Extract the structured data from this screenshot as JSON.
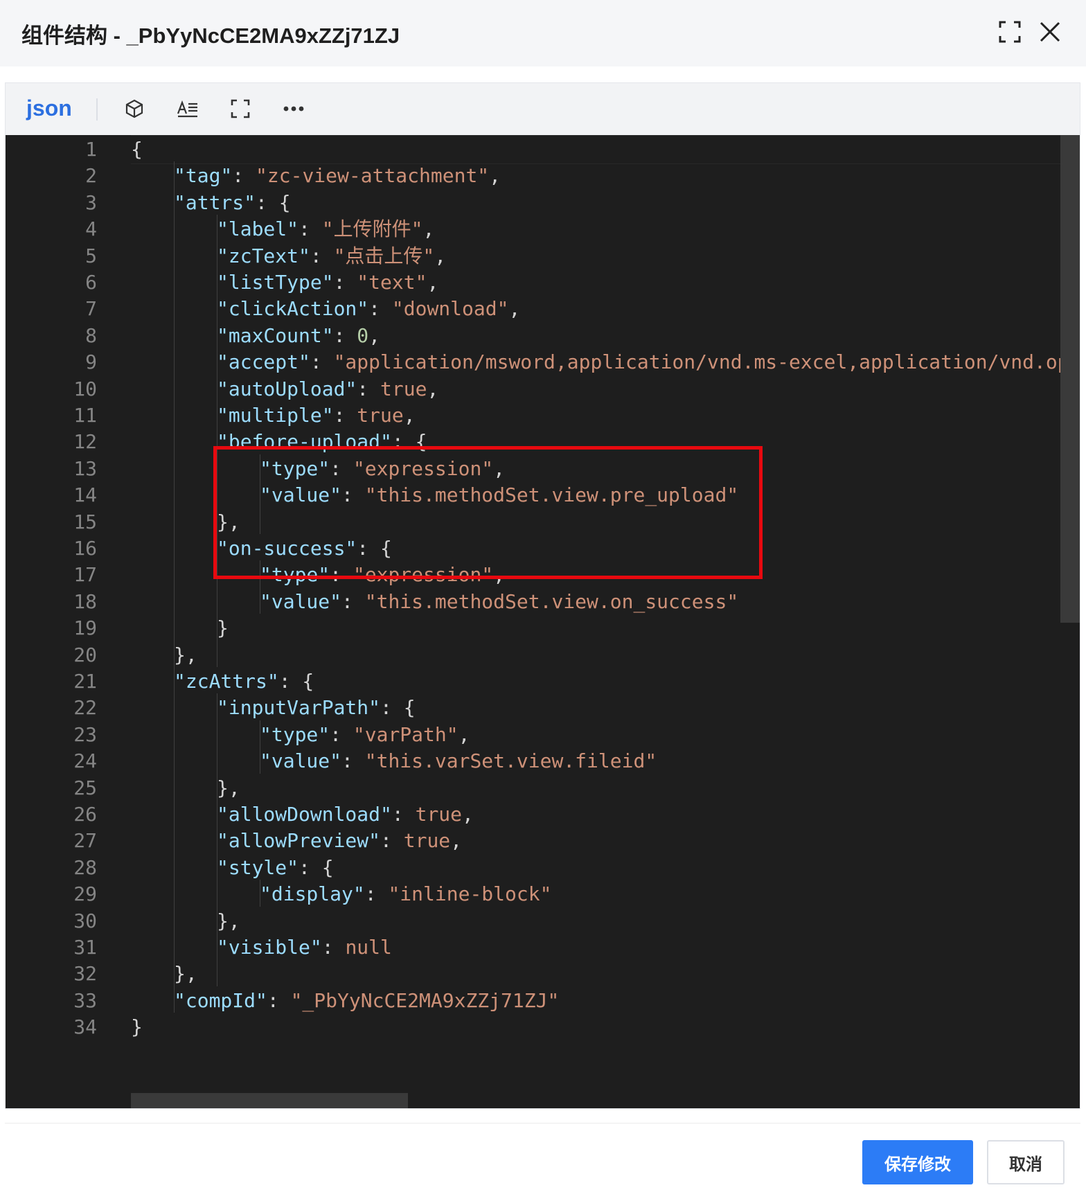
{
  "dialog": {
    "title": "组件结构 - _PbYyNcCE2MA9xZZj71ZJ",
    "fullscreen_icon": "fullscreen-icon",
    "close_icon": "close-icon"
  },
  "toolbar": {
    "language": "json",
    "icons": [
      "cube-icon",
      "format-text-icon",
      "fullscreen-icon",
      "more-icon"
    ]
  },
  "editor": {
    "line_numbers": [
      "1",
      "2",
      "3",
      "4",
      "5",
      "6",
      "7",
      "8",
      "9",
      "10",
      "11",
      "12",
      "13",
      "14",
      "15",
      "16",
      "17",
      "18",
      "19",
      "20",
      "21",
      "22",
      "23",
      "24",
      "25",
      "26",
      "27",
      "28",
      "29",
      "30",
      "31",
      "32",
      "33",
      "34"
    ],
    "lines": [
      [
        [
          "p",
          "{"
        ]
      ],
      [
        [
          "k",
          "\"tag\""
        ],
        [
          "p",
          ": "
        ],
        [
          "s",
          "\"zc-view-attachment\""
        ],
        [
          "p",
          ","
        ]
      ],
      [
        [
          "k",
          "\"attrs\""
        ],
        [
          "p",
          ": {"
        ]
      ],
      [
        [
          "k",
          "\"label\""
        ],
        [
          "p",
          ": "
        ],
        [
          "s",
          "\"上传附件\""
        ],
        [
          "p",
          ","
        ]
      ],
      [
        [
          "k",
          "\"zcText\""
        ],
        [
          "p",
          ": "
        ],
        [
          "s",
          "\"点击上传\""
        ],
        [
          "p",
          ","
        ]
      ],
      [
        [
          "k",
          "\"listType\""
        ],
        [
          "p",
          ": "
        ],
        [
          "s",
          "\"text\""
        ],
        [
          "p",
          ","
        ]
      ],
      [
        [
          "k",
          "\"clickAction\""
        ],
        [
          "p",
          ": "
        ],
        [
          "s",
          "\"download\""
        ],
        [
          "p",
          ","
        ]
      ],
      [
        [
          "k",
          "\"maxCount\""
        ],
        [
          "p",
          ": "
        ],
        [
          "n",
          "0"
        ],
        [
          "p",
          ","
        ]
      ],
      [
        [
          "k",
          "\"accept\""
        ],
        [
          "p",
          ": "
        ],
        [
          "s",
          "\"application/msword,application/vnd.ms-excel,application/vnd.ope"
        ]
      ],
      [
        [
          "k",
          "\"autoUpload\""
        ],
        [
          "p",
          ": "
        ],
        [
          "s",
          "true"
        ],
        [
          "p",
          ","
        ]
      ],
      [
        [
          "k",
          "\"multiple\""
        ],
        [
          "p",
          ": "
        ],
        [
          "s",
          "true"
        ],
        [
          "p",
          ","
        ]
      ],
      [
        [
          "k",
          "\"before-upload\""
        ],
        [
          "p",
          ": {"
        ]
      ],
      [
        [
          "k",
          "\"type\""
        ],
        [
          "p",
          ": "
        ],
        [
          "s",
          "\"expression\""
        ],
        [
          "p",
          ","
        ]
      ],
      [
        [
          "k",
          "\"value\""
        ],
        [
          "p",
          ": "
        ],
        [
          "s",
          "\"this.methodSet.view.pre_upload\""
        ]
      ],
      [
        [
          "p",
          "},"
        ]
      ],
      [
        [
          "k",
          "\"on-success\""
        ],
        [
          "p",
          ": {"
        ]
      ],
      [
        [
          "k",
          "\"type\""
        ],
        [
          "p",
          ": "
        ],
        [
          "s",
          "\"expression\""
        ],
        [
          "p",
          ","
        ]
      ],
      [
        [
          "k",
          "\"value\""
        ],
        [
          "p",
          ": "
        ],
        [
          "s",
          "\"this.methodSet.view.on_success\""
        ]
      ],
      [
        [
          "p",
          "}"
        ]
      ],
      [
        [
          "p",
          "},"
        ]
      ],
      [
        [
          "k",
          "\"zcAttrs\""
        ],
        [
          "p",
          ": {"
        ]
      ],
      [
        [
          "k",
          "\"inputVarPath\""
        ],
        [
          "p",
          ": {"
        ]
      ],
      [
        [
          "k",
          "\"type\""
        ],
        [
          "p",
          ": "
        ],
        [
          "s",
          "\"varPath\""
        ],
        [
          "p",
          ","
        ]
      ],
      [
        [
          "k",
          "\"value\""
        ],
        [
          "p",
          ": "
        ],
        [
          "s",
          "\"this.varSet.view.fileid\""
        ]
      ],
      [
        [
          "p",
          "},"
        ]
      ],
      [
        [
          "k",
          "\"allowDownload\""
        ],
        [
          "p",
          ": "
        ],
        [
          "s",
          "true"
        ],
        [
          "p",
          ","
        ]
      ],
      [
        [
          "k",
          "\"allowPreview\""
        ],
        [
          "p",
          ": "
        ],
        [
          "s",
          "true"
        ],
        [
          "p",
          ","
        ]
      ],
      [
        [
          "k",
          "\"style\""
        ],
        [
          "p",
          ": {"
        ]
      ],
      [
        [
          "k",
          "\"display\""
        ],
        [
          "p",
          ": "
        ],
        [
          "s",
          "\"inline-block\""
        ]
      ],
      [
        [
          "p",
          "},"
        ]
      ],
      [
        [
          "k",
          "\"visible\""
        ],
        [
          "p",
          ": "
        ],
        [
          "s",
          "null"
        ]
      ],
      [
        [
          "p",
          "},"
        ]
      ],
      [
        [
          "k",
          "\"compId\""
        ],
        [
          "p",
          ": "
        ],
        [
          "s",
          "\"_PbYyNcCE2MA9xZZj71ZJ\""
        ]
      ],
      [
        [
          "p",
          "}"
        ]
      ]
    ],
    "highlighted_lines": [
      12,
      15
    ],
    "highlight_color": "#e8090f"
  },
  "footer": {
    "save_label": "保存修改",
    "cancel_label": "取消",
    "primary_color": "#2c7cf6"
  }
}
